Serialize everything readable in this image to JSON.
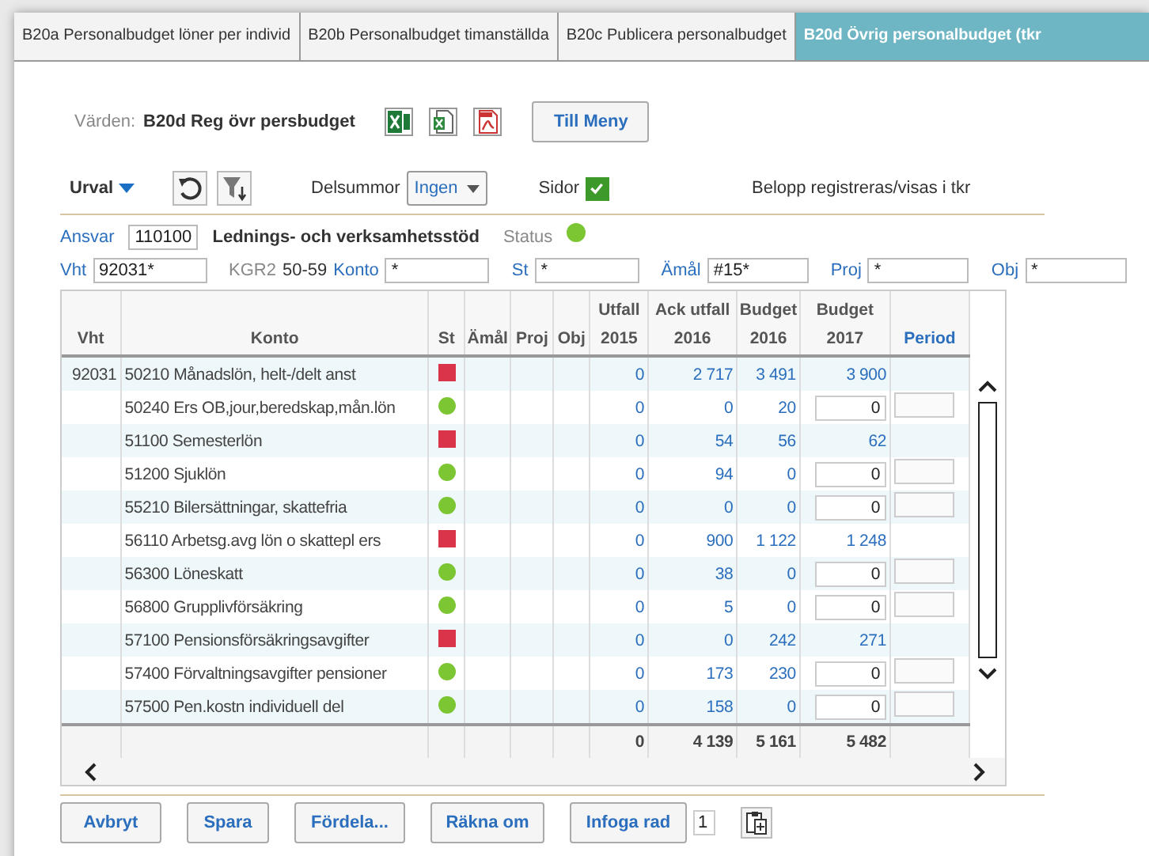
{
  "tabs": [
    {
      "label": "B20a Personalbudget löner per individ",
      "selected": false
    },
    {
      "label": "B20b Personalbudget timanställda",
      "selected": false
    },
    {
      "label": "B20c Publicera personalbudget",
      "selected": false
    },
    {
      "label": "B20d Övrig personalbudget (tkr",
      "selected": true
    }
  ],
  "toolbar": {
    "label": "Värden:",
    "value": "B20d Reg övr persbudget",
    "menu_button": "Till Meny"
  },
  "filterbar": {
    "urval": "Urval",
    "delsummor_label": "Delsummor",
    "delsummor_value": "Ingen",
    "sidor_label": "Sidor",
    "sidor_checked": true,
    "note": "Belopp registreras/visas i tkr"
  },
  "ansvar": {
    "label": "Ansvar",
    "value": "110100",
    "name": "Lednings- och verksamhetsstöd",
    "status_label": "Status",
    "color": "#7cc633"
  },
  "fields": [
    {
      "kind": "field",
      "label": "Vht",
      "value": "92031*"
    },
    {
      "kind": "text",
      "label": "KGR2",
      "value": "50-59"
    },
    {
      "kind": "field",
      "label": "Konto",
      "value": "*"
    },
    {
      "kind": "field",
      "label": "St",
      "value": "*"
    },
    {
      "kind": "field",
      "label": "Ämål",
      "value": "#15*"
    },
    {
      "kind": "field",
      "label": "Proj",
      "value": "*"
    },
    {
      "kind": "field",
      "label": "Obj",
      "value": "*"
    }
  ],
  "table": {
    "columns": [
      {
        "line2": "Vht"
      },
      {
        "line2": "Konto"
      },
      {
        "line2": "St"
      },
      {
        "line2": "Ämål"
      },
      {
        "line2": "Proj"
      },
      {
        "line2": "Obj"
      },
      {
        "line1": "Utfall",
        "line2": "2015"
      },
      {
        "line1": "Ack utfall",
        "line2": "2016"
      },
      {
        "line1": "Budget",
        "line2": "2016"
      },
      {
        "line1": "Budget",
        "line2": "2017"
      },
      {
        "line2": "Period",
        "kind": "link"
      }
    ],
    "rows": [
      {
        "vht": "92031",
        "konto": "50210 Månadslön, helt-/delt anst",
        "color": "#d9344a",
        "utfall_2015": "0",
        "ack_utfall_2016": "2 717",
        "budget_2016": "3 491",
        "budget_2017": "3 900",
        "editable": false
      },
      {
        "konto": "50240 Ers OB,jour,beredskap,mån.lön",
        "color": "#7cc633",
        "utfall_2015": "0",
        "ack_utfall_2016": "0",
        "budget_2016": "20",
        "budget_2017": "0",
        "editable": true
      },
      {
        "konto": "51100 Semesterlön",
        "color": "#d9344a",
        "utfall_2015": "0",
        "ack_utfall_2016": "54",
        "budget_2016": "56",
        "budget_2017": "62",
        "editable": false
      },
      {
        "konto": "51200 Sjuklön",
        "color": "#7cc633",
        "utfall_2015": "0",
        "ack_utfall_2016": "94",
        "budget_2016": "0",
        "budget_2017": "0",
        "editable": true
      },
      {
        "konto": "55210 Bilersättningar, skattefria",
        "color": "#7cc633",
        "utfall_2015": "0",
        "ack_utfall_2016": "0",
        "budget_2016": "0",
        "budget_2017": "0",
        "editable": true
      },
      {
        "konto": "56110 Arbetsg.avg lön o skattepl ers",
        "color": "#d9344a",
        "utfall_2015": "0",
        "ack_utfall_2016": "900",
        "budget_2016": "1 122",
        "budget_2017": "1 248",
        "editable": false
      },
      {
        "konto": "56300 Löneskatt",
        "color": "#7cc633",
        "utfall_2015": "0",
        "ack_utfall_2016": "38",
        "budget_2016": "0",
        "budget_2017": "0",
        "editable": true
      },
      {
        "konto": "56800 Grupplivförsäkring",
        "color": "#7cc633",
        "utfall_2015": "0",
        "ack_utfall_2016": "5",
        "budget_2016": "0",
        "budget_2017": "0",
        "editable": true
      },
      {
        "konto": "57100 Pensionsförsäkringsavgifter",
        "color": "#d9344a",
        "utfall_2015": "0",
        "ack_utfall_2016": "0",
        "budget_2016": "242",
        "budget_2017": "271",
        "editable": false
      },
      {
        "konto": "57400 Förvaltningsavgifter pensioner",
        "color": "#7cc633",
        "utfall_2015": "0",
        "ack_utfall_2016": "173",
        "budget_2016": "230",
        "budget_2017": "0",
        "editable": true
      },
      {
        "konto": "57500 Pen.kostn individuell del",
        "color": "#7cc633",
        "utfall_2015": "0",
        "ack_utfall_2016": "158",
        "budget_2016": "0",
        "budget_2017": "0",
        "editable": true
      }
    ],
    "totals": {
      "utfall_2015": "0",
      "ack_utfall_2016": "4 139",
      "budget_2016": "5 161",
      "budget_2017": "5 482"
    }
  },
  "buttons": [
    {
      "label": "Avbryt"
    },
    {
      "label": "Spara"
    },
    {
      "label": "Fördela..."
    },
    {
      "label": "Räkna om"
    },
    {
      "label": "Infoga rad"
    }
  ],
  "row_count": "1"
}
